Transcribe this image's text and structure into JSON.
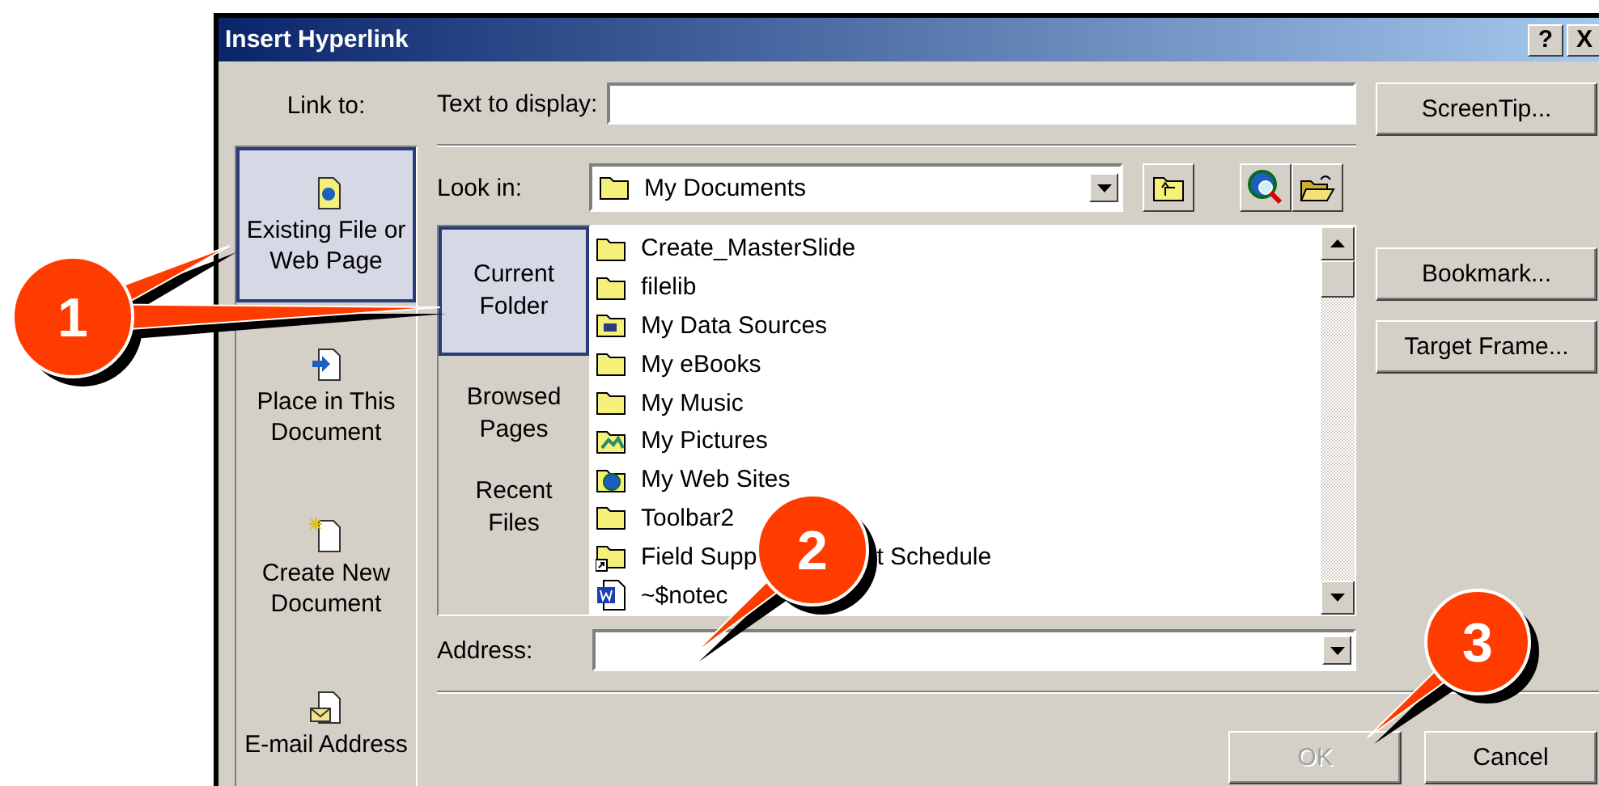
{
  "window": {
    "title": "Insert Hyperlink",
    "help_button": "?",
    "close_button": "X"
  },
  "link_to": {
    "label": "Link to:",
    "items": [
      {
        "lines": [
          "Existing File or",
          "Web Page"
        ],
        "kind": "file",
        "selected": true
      },
      {
        "lines": [
          "Place in This",
          "Document"
        ],
        "kind": "place",
        "selected": false
      },
      {
        "lines": [
          "Create New",
          "Document"
        ],
        "kind": "new",
        "selected": false
      },
      {
        "lines": [
          "E-mail Address"
        ],
        "kind": "email",
        "selected": false
      }
    ]
  },
  "text_to_display": {
    "label": "Text to display:"
  },
  "screentip_button": "ScreenTip...",
  "look_in": {
    "label": "Look in:",
    "value": "My Documents"
  },
  "sub_nav": [
    {
      "lines": [
        "Current",
        "Folder"
      ],
      "selected": true
    },
    {
      "lines": [
        "Browsed",
        "Pages"
      ],
      "selected": false
    },
    {
      "lines": [
        "Recent",
        "Files"
      ],
      "selected": false
    }
  ],
  "files": [
    {
      "name": "Create_MasterSlide",
      "kind": "folder"
    },
    {
      "name": "filelib",
      "kind": "folder"
    },
    {
      "name": "My Data Sources",
      "kind": "datasource"
    },
    {
      "name": "My eBooks",
      "kind": "folder"
    },
    {
      "name": "My Music",
      "kind": "folder"
    },
    {
      "name": "My Pictures",
      "kind": "pictures"
    },
    {
      "name": "My Web Sites",
      "kind": "websites"
    },
    {
      "name": "Toolbar2",
      "kind": "folder"
    },
    {
      "name": "Field Supp",
      "name_tail": "t Schedule",
      "kind": "shortcut"
    },
    {
      "name": "~$notec",
      "kind": "word"
    }
  ],
  "side_buttons": [
    "Bookmark...",
    "Target Frame..."
  ],
  "address": {
    "label": "Address:"
  },
  "ok_button": {
    "label": "OK",
    "disabled": true
  },
  "cancel_button": {
    "label": "Cancel",
    "disabled": false
  },
  "callouts": [
    {
      "number": "1"
    },
    {
      "number": "2"
    },
    {
      "number": "3"
    }
  ]
}
